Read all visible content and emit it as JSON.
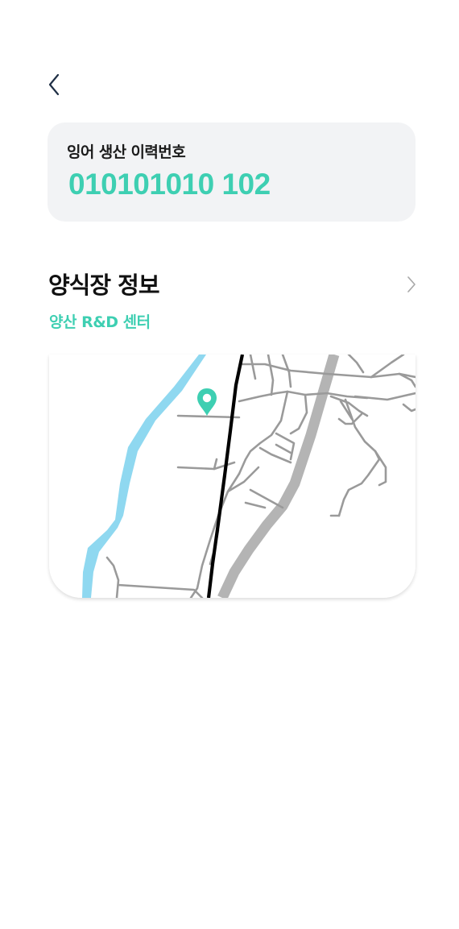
{
  "header": {
    "back_icon": "chevron-left-icon"
  },
  "trace_card": {
    "label": "잉어 생산 이력번호",
    "number": "010101010 102"
  },
  "farm_section": {
    "title": "양식장 정보",
    "farm_name": "양산 R&D 센터",
    "chevron_icon": "chevron-right-icon"
  },
  "map": {
    "marker_icon": "map-pin-icon",
    "colors": {
      "river": "#8fd8f0",
      "railway": "#000000",
      "highway": "#b4b4b4",
      "road": "#9a9a9a",
      "marker": "#3ecfb2"
    }
  },
  "colors": {
    "accent": "#3ecfb2",
    "card_background": "#f2f3f5",
    "text_primary": "#111111"
  }
}
